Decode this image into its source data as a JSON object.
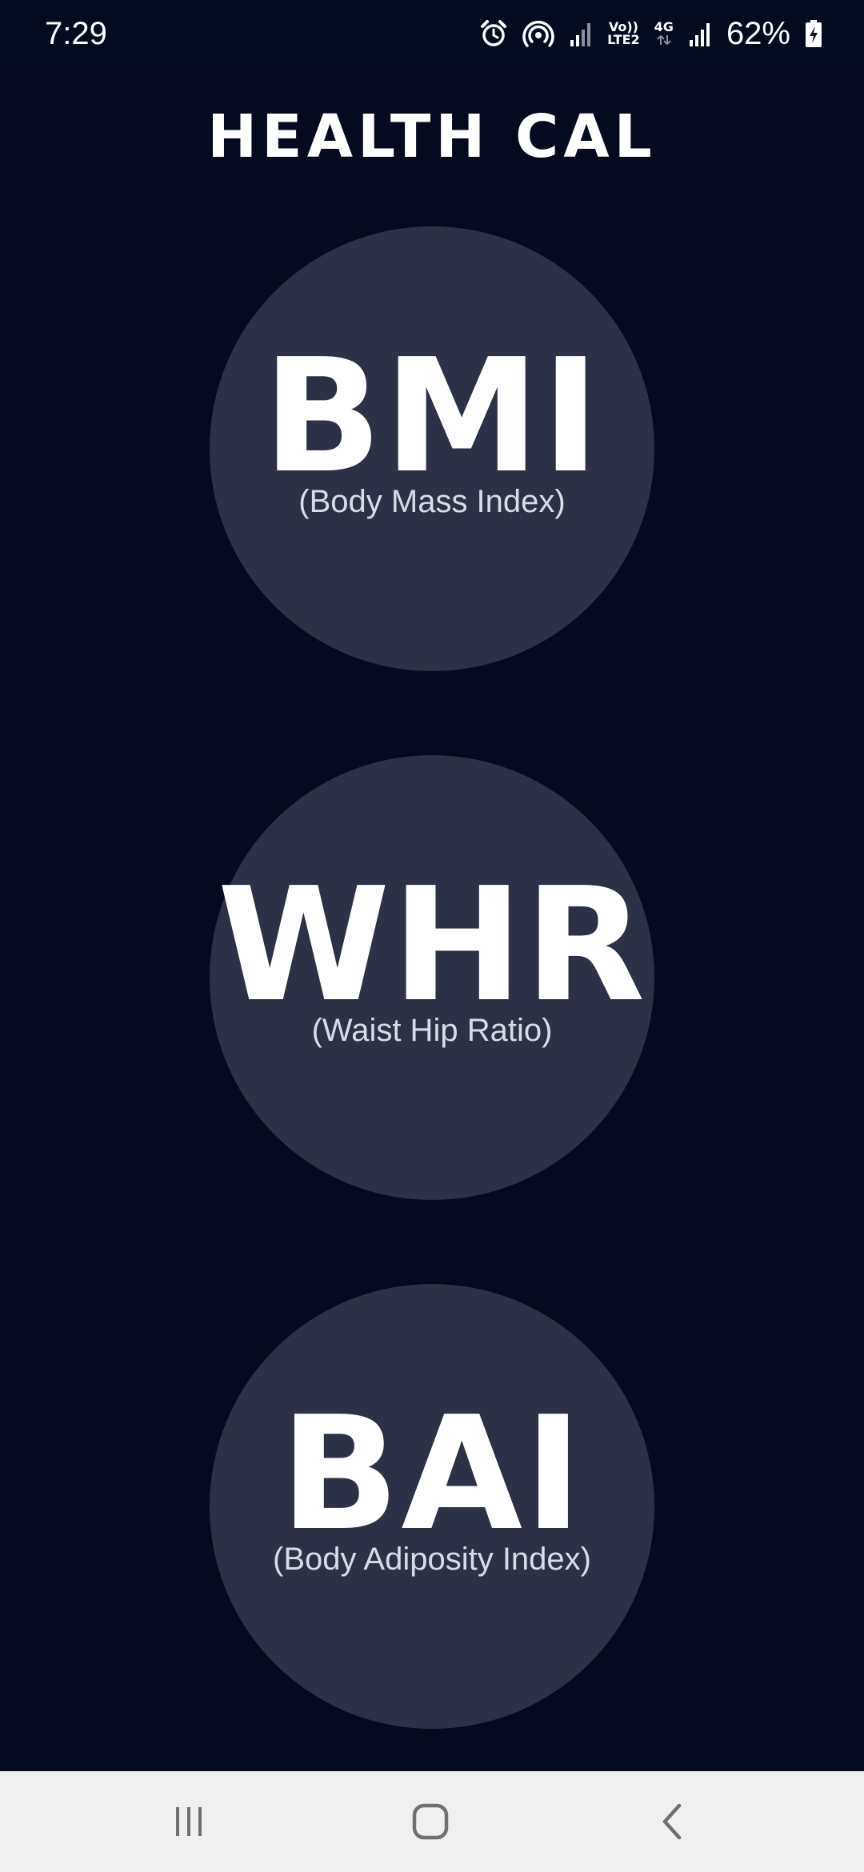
{
  "status_bar": {
    "time": "7:29",
    "net_top": "Vo))",
    "net_bottom": "LTE2",
    "net_type": "4G",
    "battery_percent": "62%",
    "icons": [
      "alarm-icon",
      "hotspot-icon",
      "signal-icon",
      "signal-icon",
      "battery-charging-icon"
    ]
  },
  "app": {
    "title": "HEALTH CAL"
  },
  "calculators": [
    {
      "abbr": "BMI",
      "subtitle": "(Body Mass Index)"
    },
    {
      "abbr": "WHR",
      "subtitle": "(Waist Hip Ratio)"
    },
    {
      "abbr": "BAI",
      "subtitle": "(Body Adiposity Index)"
    }
  ],
  "nav_bar": {
    "icons": [
      "recents-icon",
      "home-icon",
      "back-icon"
    ]
  },
  "colors": {
    "background": "#050a1e",
    "circle": "#2c3145",
    "nav_bar": "#f0f0f0"
  }
}
